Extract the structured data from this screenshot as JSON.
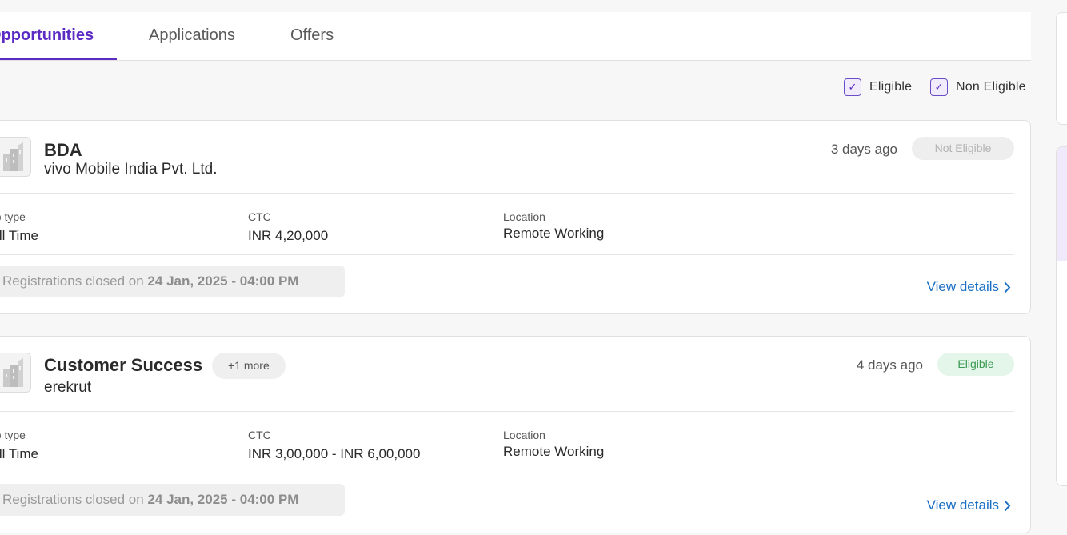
{
  "tabs": [
    {
      "label": "Opportunities",
      "active": true
    },
    {
      "label": "Applications",
      "active": false
    },
    {
      "label": "Offers",
      "active": false
    }
  ],
  "filters": [
    {
      "label": "Eligible",
      "checked": true,
      "check": "✓"
    },
    {
      "label": "Non Eligible",
      "checked": true,
      "check": "✓"
    }
  ],
  "jobs": [
    {
      "title": "BDA",
      "company": "vivo Mobile India Pvt. Ltd.",
      "posted": "3 days ago",
      "status": "Not Eligible",
      "job_type_label": "Job type",
      "job_type": "Full Time",
      "ctc_label": "CTC",
      "ctc": "INR 4,20,000",
      "location_label": "Location",
      "location": "Remote Working",
      "reg_prefix": "Registrations closed on ",
      "reg_date": "24 Jan, 2025 - 04:00 PM",
      "view_label": "View details"
    },
    {
      "title": "Customer Success",
      "more": "+1 more",
      "company": "erekrut",
      "posted": "4 days ago",
      "status": "Eligible",
      "job_type_label": "Job type",
      "job_type": "Full Time",
      "ctc_label": "CTC",
      "ctc": "INR 3,00,000 - INR 6,00,000",
      "location_label": "Location",
      "location": "Remote Working",
      "reg_prefix": "Registrations closed on ",
      "reg_date": "24 Jan, 2025 - 04:00 PM",
      "view_label": "View details"
    }
  ],
  "colors": {
    "accent": "#5b2bc4",
    "link": "#1a6fc4",
    "eligible": "#3a9a52",
    "not_eligible": "#b4b4b4"
  }
}
